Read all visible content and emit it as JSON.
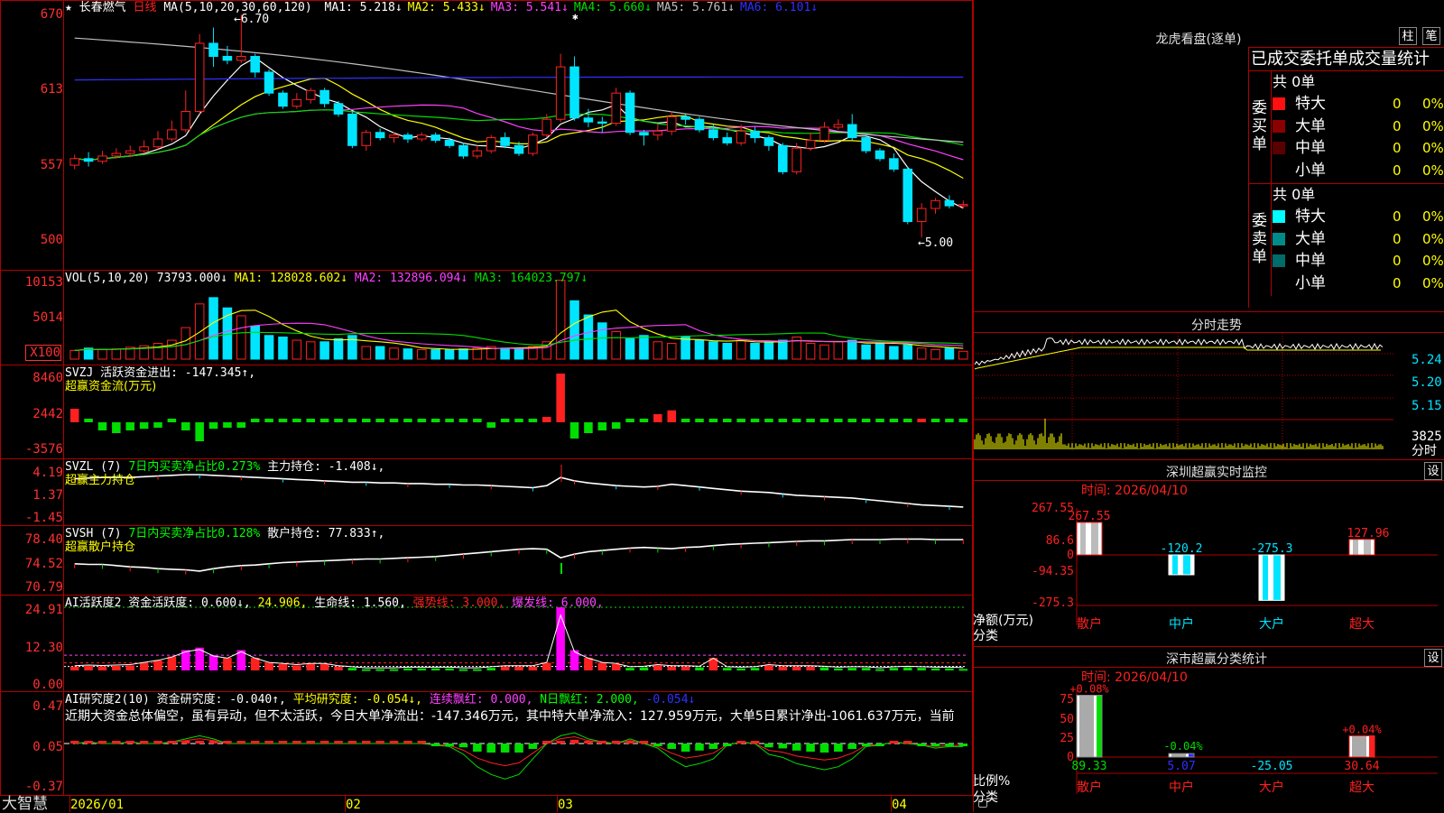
{
  "colors": {
    "up": "#ff2020",
    "down": "#00e5ff",
    "ma1": "#ffffff",
    "ma2": "#ffff00",
    "ma3": "#ff40ff",
    "ma4": "#00dd00",
    "ma5": "#c0c0c0",
    "ma6": "#3030ff"
  },
  "main": {
    "stock_name": "长春燃气",
    "period": "日线",
    "ma_header": "MA(5,10,20,30,60,120)",
    "ma_items": [
      {
        "label": "MA1:",
        "value": "5.218↓",
        "color": "#ffffff"
      },
      {
        "label": "MA2:",
        "value": "5.433↓",
        "color": "#ffff00"
      },
      {
        "label": "MA3:",
        "value": "5.541↓",
        "color": "#ff40ff"
      },
      {
        "label": "MA4:",
        "value": "5.660↓",
        "color": "#00dd00"
      },
      {
        "label": "MA5:",
        "value": "5.761↓",
        "color": "#c0c0c0"
      },
      {
        "label": "MA6:",
        "value": "6.101↓",
        "color": "#3030ff"
      }
    ],
    "high_marker": "←6.70",
    "low_marker": "←5.00",
    "y_ticks": [
      "670",
      "613",
      "557",
      "500"
    ]
  },
  "vol": {
    "header": "VOL(5,10,20)",
    "value": "73793.000↓",
    "ma1": "MA1: 128028.602↓",
    "ma2": "MA2: 132896.094↓",
    "ma3": "MA3: 164023.797↓",
    "y_ticks": [
      "10153",
      "5014",
      "X100"
    ]
  },
  "svzj": {
    "header": "SVZJ  活跃资金进出: -147.345↑,",
    "sub": "超赢资金流(万元)",
    "y_ticks": [
      "8460",
      "2442",
      "-3576"
    ]
  },
  "svzl": {
    "header_a": "SVZL (7)",
    "header_b": "7日内买卖净占比0.273%",
    "header_c": "主力持仓: -1.408↓,",
    "sub": "超赢主力持仓",
    "y_ticks": [
      "4.19",
      "1.37",
      "-1.45"
    ]
  },
  "svsh": {
    "header_a": "SVSH (7)",
    "header_b": "7日内买卖净占比0.128%",
    "header_c": "散户持仓: 77.833↑,",
    "sub": "超赢散户持仓",
    "y_ticks": [
      "78.40",
      "74.52",
      "70.79"
    ]
  },
  "ai": {
    "header": "AI活跃度2 资金活跃度: 0.600↓,",
    "v2": "24.906,",
    "v3": "生命线: 1.560,",
    "v4": "强势线: 3.000,",
    "v5": "爆发线: 6.000,",
    "y_ticks": [
      "24.91",
      "12.30",
      "0.00"
    ]
  },
  "air": {
    "header": "AI研究度2(10) 资金研究度: -0.040↑,",
    "v2": "平均研究度: -0.054↓,",
    "v3": "连续飘红: 0.000,",
    "v4": "N日飘红: 2.000,",
    "v5": "-0.054↓",
    "comment": "近期大资金总体偏空，虽有异动，但不太活跃，今日大单净流出：-147.346万元，其中特大单净流入：127.959万元，大单5日累计净出-1061.637万元，当前",
    "y_ticks": [
      "0.47",
      "0.05",
      "-0.37"
    ]
  },
  "bottom": {
    "logo": "大智慧",
    "dates": [
      "2026/01",
      "02",
      "03",
      "04"
    ]
  },
  "right": {
    "lhb_title": "龙虎看盘(逐单)",
    "btn1": "柱",
    "btn2": "笔",
    "tabs_title": "已成交委托单成交量统计",
    "buy_total": "共 0单",
    "sell_total": "共 0单",
    "buy_label": "委买单",
    "sell_label": "委卖单",
    "buy_rows": [
      {
        "name": "特大",
        "n": "0",
        "p": "0%",
        "c": "#ff1010"
      },
      {
        "name": "大单",
        "n": "0",
        "p": "0%",
        "c": "#8b0000"
      },
      {
        "name": "中单",
        "n": "0",
        "p": "0%",
        "c": "#5a0000"
      },
      {
        "name": "小单",
        "n": "0",
        "p": "0%",
        "c": "#000000"
      }
    ],
    "sell_rows": [
      {
        "name": "特大",
        "n": "0",
        "p": "0%",
        "c": "#00ffff"
      },
      {
        "name": "大单",
        "n": "0",
        "p": "0%",
        "c": "#008b8b"
      },
      {
        "name": "中单",
        "n": "0",
        "p": "0%",
        "c": "#006b6b"
      },
      {
        "name": "小单",
        "n": "0",
        "p": "0%",
        "c": "#000000"
      }
    ],
    "fs_title": "分时走势",
    "fs_y": [
      "5.24",
      "5.20",
      "5.15"
    ],
    "fs_vol": "3825",
    "fs_vol2": "分时",
    "sz_title": "深圳超赢实时监控",
    "sz_btn": "设",
    "sz_time": "时间: 2026/04/10",
    "sz_y": [
      "267.55",
      "86.6",
      "0",
      "-94.35",
      "-275.3"
    ],
    "sz_ylabel": "净额(万元)",
    "sz_xlabel": "分类",
    "sz_cats": [
      "散户",
      "中户",
      "大户",
      "超大"
    ],
    "sz_vals": [
      267.55,
      -120.2,
      -275.3,
      127.96
    ],
    "sz_lbls": [
      "267.55",
      "-120.2",
      "-275.3",
      "127.96"
    ],
    "fl_title": "深市超赢分类统计",
    "fl_btn": "设",
    "fl_time": "时间: 2026/04/10",
    "fl_y": [
      "75",
      "50",
      "25",
      "0"
    ],
    "fl_ylabel": "比例%",
    "fl_xlabel": "分类",
    "fl_cats": [
      "散户",
      "中户",
      "大户",
      "超大"
    ],
    "fl_top": [
      "+0.08%",
      "-0.04%",
      "",
      "+0.04%"
    ],
    "fl_vals": [
      "89.33",
      "5.07",
      "-25.05",
      "30.64"
    ],
    "fl_bar": [
      89.33,
      5.07,
      0,
      30.64
    ]
  },
  "chart_data": {
    "type": "candlestick",
    "title": "长春燃气 日线",
    "x": [
      "2026/01",
      "02",
      "03",
      "04"
    ],
    "ylim": [
      5.0,
      6.7
    ],
    "candles": [
      [
        5.55,
        5.6,
        5.63,
        5.52
      ],
      [
        5.6,
        5.58,
        5.65,
        5.54
      ],
      [
        5.58,
        5.62,
        5.66,
        5.56
      ],
      [
        5.62,
        5.64,
        5.68,
        5.6
      ],
      [
        5.64,
        5.66,
        5.7,
        5.61
      ],
      [
        5.66,
        5.69,
        5.74,
        5.64
      ],
      [
        5.69,
        5.75,
        5.81,
        5.67
      ],
      [
        5.75,
        5.82,
        5.89,
        5.73
      ],
      [
        5.82,
        5.96,
        6.12,
        5.8
      ],
      [
        5.96,
        6.48,
        6.55,
        5.94
      ],
      [
        6.48,
        6.38,
        6.6,
        6.3
      ],
      [
        6.38,
        6.35,
        6.46,
        6.32
      ],
      [
        6.35,
        6.38,
        6.7,
        6.33
      ],
      [
        6.38,
        6.26,
        6.4,
        6.22
      ],
      [
        6.26,
        6.1,
        6.28,
        6.08
      ],
      [
        6.1,
        6.0,
        6.12,
        5.98
      ],
      [
        6.0,
        6.05,
        6.1,
        5.98
      ],
      [
        6.05,
        6.12,
        6.14,
        6.02
      ],
      [
        6.12,
        6.02,
        6.14,
        5.99
      ],
      [
        6.02,
        5.94,
        6.04,
        5.92
      ],
      [
        5.94,
        5.7,
        5.96,
        5.68
      ],
      [
        5.7,
        5.8,
        5.82,
        5.66
      ],
      [
        5.8,
        5.76,
        5.83,
        5.74
      ],
      [
        5.76,
        5.78,
        5.8,
        5.72
      ],
      [
        5.78,
        5.75,
        5.8,
        5.72
      ],
      [
        5.75,
        5.78,
        5.8,
        5.73
      ],
      [
        5.78,
        5.74,
        5.8,
        5.72
      ],
      [
        5.74,
        5.7,
        5.76,
        5.68
      ],
      [
        5.7,
        5.62,
        5.72,
        5.6
      ],
      [
        5.62,
        5.66,
        5.7,
        5.6
      ],
      [
        5.66,
        5.76,
        5.78,
        5.64
      ],
      [
        5.76,
        5.7,
        5.8,
        5.68
      ],
      [
        5.7,
        5.64,
        5.73,
        5.62
      ],
      [
        5.64,
        5.78,
        5.8,
        5.62
      ],
      [
        5.78,
        5.9,
        5.94,
        5.76
      ],
      [
        5.9,
        6.3,
        6.4,
        5.88
      ],
      [
        6.3,
        5.91,
        6.38,
        5.89
      ],
      [
        5.91,
        5.88,
        5.98,
        5.84
      ],
      [
        5.88,
        5.87,
        5.92,
        5.8
      ],
      [
        5.87,
        6.1,
        6.14,
        5.85
      ],
      [
        6.1,
        5.8,
        6.12,
        5.78
      ],
      [
        5.8,
        5.78,
        5.82,
        5.7
      ],
      [
        5.78,
        5.81,
        5.86,
        5.74
      ],
      [
        5.81,
        5.92,
        5.96,
        5.78
      ],
      [
        5.92,
        5.9,
        5.94,
        5.86
      ],
      [
        5.9,
        5.82,
        5.92,
        5.8
      ],
      [
        5.82,
        5.76,
        5.86,
        5.74
      ],
      [
        5.76,
        5.72,
        5.8,
        5.7
      ],
      [
        5.72,
        5.81,
        5.86,
        5.7
      ],
      [
        5.81,
        5.76,
        5.84,
        5.72
      ],
      [
        5.76,
        5.7,
        5.78,
        5.66
      ],
      [
        5.7,
        5.5,
        5.72,
        5.48
      ],
      [
        5.5,
        5.68,
        5.72,
        5.48
      ],
      [
        5.68,
        5.74,
        5.8,
        5.66
      ],
      [
        5.74,
        5.84,
        5.88,
        5.72
      ],
      [
        5.84,
        5.86,
        5.9,
        5.82
      ],
      [
        5.86,
        5.76,
        5.94,
        5.74
      ],
      [
        5.76,
        5.66,
        5.78,
        5.64
      ],
      [
        5.66,
        5.6,
        5.68,
        5.58
      ],
      [
        5.6,
        5.52,
        5.64,
        5.5
      ],
      [
        5.52,
        5.12,
        5.54,
        5.1
      ],
      [
        5.12,
        5.22,
        5.26,
        5.0
      ],
      [
        5.22,
        5.28,
        5.3,
        5.18
      ],
      [
        5.28,
        5.24,
        5.32,
        5.22
      ],
      [
        5.24,
        5.25,
        5.28,
        5.22
      ]
    ],
    "volume": [
      11,
      14,
      12,
      13,
      15,
      17,
      20,
      24,
      40,
      70,
      78,
      65,
      55,
      42,
      30,
      28,
      24,
      22,
      22,
      26,
      30,
      16,
      16,
      14,
      13,
      12,
      12,
      12,
      13,
      14,
      16,
      14,
      14,
      16,
      22,
      100,
      74,
      56,
      46,
      35,
      26,
      30,
      22,
      20,
      28,
      24,
      22,
      20,
      24,
      20,
      22,
      24,
      28,
      20,
      18,
      22,
      24,
      18,
      20,
      16,
      18,
      14,
      12,
      14,
      10
    ],
    "svzj": [
      2.5,
      -0.5,
      -1.5,
      -2.0,
      -1.5,
      -1.2,
      -1.0,
      -0.8,
      -1.5,
      -3.5,
      -1.2,
      -1.0,
      -1.0,
      -0.8,
      -0.9,
      -0.6,
      -0.4,
      -0.6,
      -0.7,
      -0.8,
      -0.6,
      -0.5,
      -0.6,
      -0.8,
      -0.7,
      -0.8,
      -0.9,
      -0.7,
      -0.8,
      -0.9,
      -1.0,
      -0.8,
      -0.7,
      -0.6,
      1.0,
      9.0,
      -3.0,
      -2.0,
      -1.5,
      -1.2,
      -0.8,
      -0.6,
      1.5,
      2.2,
      -0.8,
      -0.6,
      -0.4,
      -0.5,
      -0.6,
      -0.6,
      -0.4,
      -0.3,
      -0.5,
      -0.6,
      -0.8,
      -0.6,
      -0.5,
      -0.4,
      -0.5,
      -0.6,
      -0.4,
      0.2,
      -0.3,
      -0.3,
      -0.3
    ],
    "svzl": [
      2.8,
      2.9,
      3.0,
      3.0,
      3.0,
      3.1,
      3.2,
      3.3,
      3.4,
      3.4,
      3.3,
      3.2,
      3.1,
      3.0,
      2.9,
      2.8,
      2.7,
      2.6,
      2.5,
      2.4,
      2.3,
      2.3,
      2.2,
      2.2,
      2.1,
      2.1,
      2.0,
      2.0,
      1.9,
      1.9,
      1.8,
      1.7,
      1.6,
      1.5,
      1.8,
      3.0,
      2.5,
      2.2,
      2.0,
      1.8,
      1.7,
      1.6,
      1.7,
      2.0,
      1.8,
      1.6,
      1.4,
      1.2,
      1.0,
      0.9,
      0.8,
      0.6,
      0.4,
      0.3,
      0.2,
      0.1,
      0.0,
      -0.2,
      -0.4,
      -0.6,
      -0.8,
      -1.0,
      -1.1,
      -1.2,
      -1.3
    ],
    "svsh": [
      73.8,
      73.7,
      73.7,
      73.5,
      73.3,
      73.2,
      73.0,
      72.9,
      72.8,
      72.6,
      73.0,
      73.3,
      73.5,
      73.6,
      73.8,
      74.0,
      74.1,
      74.2,
      74.3,
      74.4,
      74.5,
      74.6,
      74.6,
      74.7,
      74.8,
      74.9,
      75.0,
      75.2,
      75.4,
      75.6,
      75.8,
      76.0,
      76.2,
      76.3,
      76.2,
      74.8,
      75.4,
      75.8,
      76.0,
      76.2,
      76.4,
      76.5,
      76.4,
      76.3,
      76.5,
      76.6,
      76.8,
      77.0,
      77.1,
      77.2,
      77.3,
      77.4,
      77.5,
      77.6,
      77.6,
      77.7,
      77.8,
      77.8,
      77.8,
      77.9,
      77.9,
      77.9,
      77.8,
      77.8,
      77.8
    ],
    "ai": [
      1.5,
      1.8,
      1.6,
      1.8,
      2.0,
      3.0,
      4.0,
      5.5,
      8.0,
      9.0,
      6.0,
      5.0,
      8.0,
      5.0,
      3.0,
      2.5,
      2.0,
      2.5,
      2.5,
      1.5,
      1.0,
      0.5,
      0.5,
      0.5,
      0.8,
      0.8,
      0.8,
      0.8,
      0.5,
      0.5,
      1.0,
      1.5,
      1.5,
      1.5,
      3.0,
      24.9,
      8.0,
      5.0,
      3.0,
      2.5,
      1.0,
      1.2,
      2.0,
      1.5,
      1.5,
      1.2,
      5.0,
      1.0,
      0.8,
      1.0,
      2.0,
      1.5,
      1.5,
      1.5,
      1.2,
      0.8,
      1.0,
      1.0,
      0.5,
      1.0,
      1.2,
      1.0,
      0.8,
      0.8,
      0.6
    ],
    "air": [
      0.05,
      0.06,
      0.05,
      0.05,
      0.06,
      0.05,
      0.05,
      0.06,
      0.08,
      0.1,
      0.08,
      0.05,
      0.05,
      0.05,
      0.05,
      0.05,
      0.05,
      0.05,
      0.05,
      0.05,
      0.05,
      0.05,
      0.05,
      0.05,
      0.05,
      0.05,
      0.04,
      0.03,
      -0.02,
      -0.1,
      -0.15,
      -0.18,
      -0.15,
      -0.05,
      0.05,
      0.1,
      0.12,
      0.08,
      0.06,
      0.05,
      0.08,
      0.05,
      0.02,
      -0.05,
      -0.1,
      -0.08,
      -0.05,
      0.04,
      0.06,
      0.05,
      -0.02,
      -0.04,
      -0.08,
      -0.1,
      -0.12,
      -0.1,
      -0.05,
      0.03,
      0.04,
      0.06,
      0.05,
      0.04,
      0.02,
      0.03,
      0.03
    ]
  }
}
